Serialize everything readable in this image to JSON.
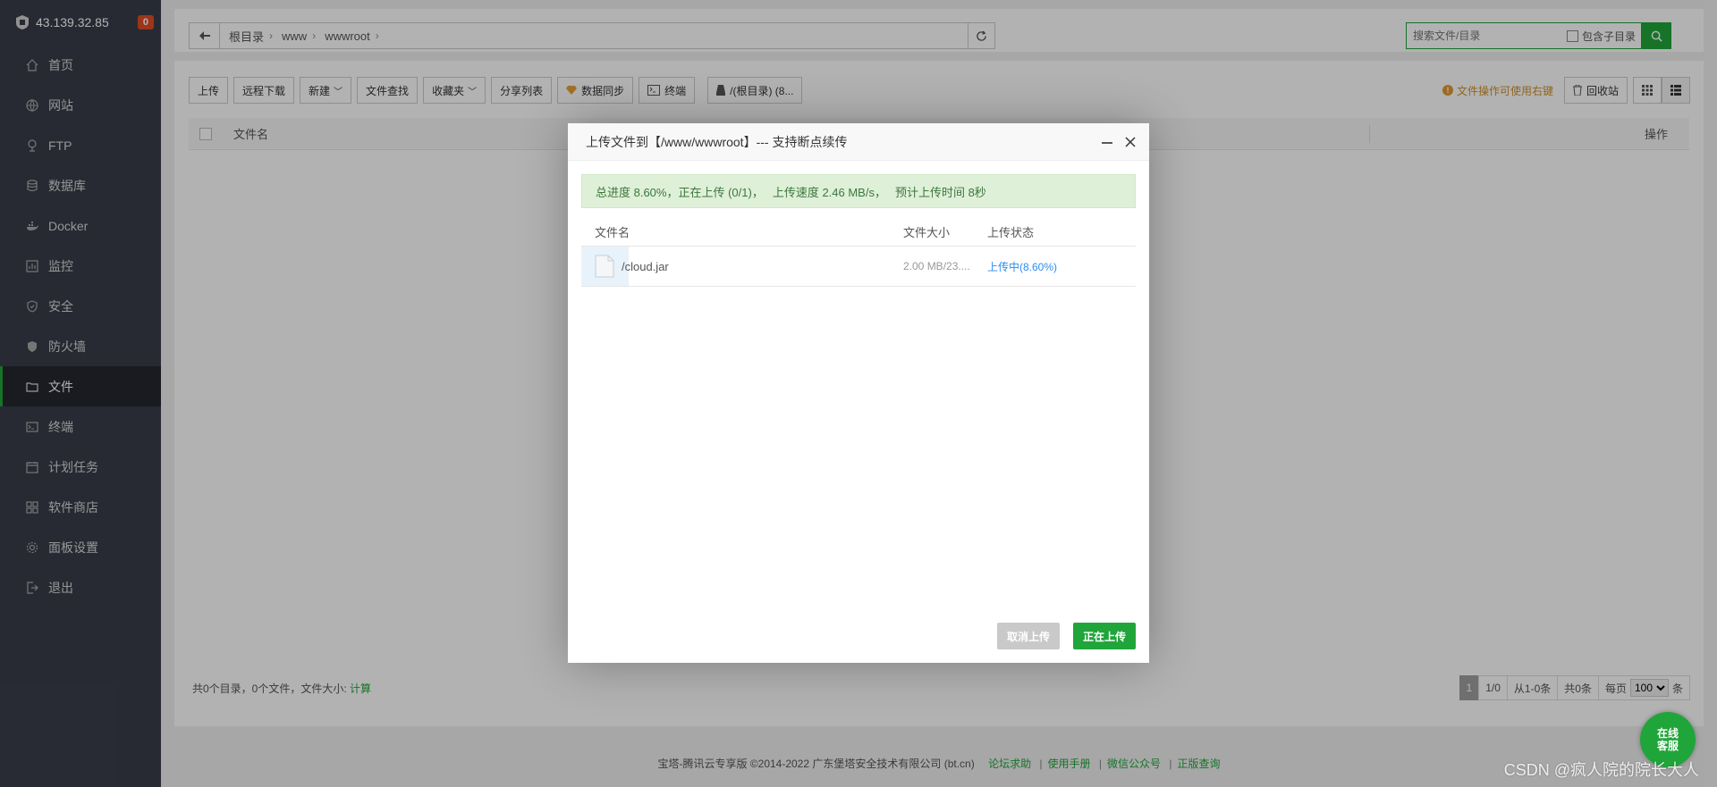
{
  "sidebar": {
    "ip": "43.139.32.85",
    "badge": "0",
    "items": [
      {
        "label": "首页",
        "icon": "home-icon"
      },
      {
        "label": "网站",
        "icon": "globe-icon"
      },
      {
        "label": "FTP",
        "icon": "ftp-icon"
      },
      {
        "label": "数据库",
        "icon": "database-icon"
      },
      {
        "label": "Docker",
        "icon": "docker-icon"
      },
      {
        "label": "监控",
        "icon": "monitor-icon"
      },
      {
        "label": "安全",
        "icon": "shield-icon"
      },
      {
        "label": "防火墙",
        "icon": "firewall-icon"
      },
      {
        "label": "文件",
        "icon": "folder-icon",
        "active": true
      },
      {
        "label": "终端",
        "icon": "terminal-icon"
      },
      {
        "label": "计划任务",
        "icon": "calendar-icon"
      },
      {
        "label": "软件商店",
        "icon": "grid-icon"
      },
      {
        "label": "面板设置",
        "icon": "gear-icon"
      },
      {
        "label": "退出",
        "icon": "logout-icon"
      }
    ]
  },
  "breadcrumb": {
    "segments": [
      "根目录",
      "www",
      "wwwroot"
    ]
  },
  "search": {
    "placeholder": "搜索文件/目录",
    "include_sub": "包含子目录"
  },
  "toolbar": {
    "upload": "上传",
    "remote_download": "远程下载",
    "new": "新建",
    "file_search": "文件查找",
    "favorites": "收藏夹",
    "share_list": "分享列表",
    "data_sync": "数据同步",
    "terminal": "终端",
    "disk": "/(根目录) (8...",
    "hint": "文件操作可使用右键",
    "recycle": "回收站"
  },
  "table": {
    "col_name": "文件名",
    "col_op": "操作"
  },
  "footer": {
    "summary": "共0个目录，0个文件，文件大小:",
    "calc": "计算"
  },
  "pager": {
    "current": "1",
    "pages": "1/0",
    "range": "从1-0条",
    "total": "共0条",
    "per_page_label": "每页",
    "per_page": "100",
    "unit": "条"
  },
  "copyright": {
    "text": "宝塔-腾讯云专享版 ©2014-2022 广东堡塔安全技术有限公司 (bt.cn)",
    "links": [
      "论坛求助",
      "使用手册",
      "微信公众号",
      "正版查询"
    ]
  },
  "dialog": {
    "title": "上传文件到【/www/wwwroot】--- 支持断点续传",
    "progress": {
      "total": "总进度 8.60%，正在上传 (0/1)，",
      "speed": "上传速度 2.46 MB/s，",
      "eta": "预计上传时间 8秒"
    },
    "headers": [
      "文件名",
      "文件大小",
      "上传状态"
    ],
    "files": [
      {
        "name": "/cloud.jar",
        "size": "2.00 MB/23....",
        "status": "上传中(8.60%)",
        "progress": 0.086
      }
    ],
    "cancel": "取消上传",
    "uploading": "正在上传"
  },
  "service": {
    "line1": "在线",
    "line2": "客服"
  },
  "watermark": "CSDN @疯人院的院长大人"
}
